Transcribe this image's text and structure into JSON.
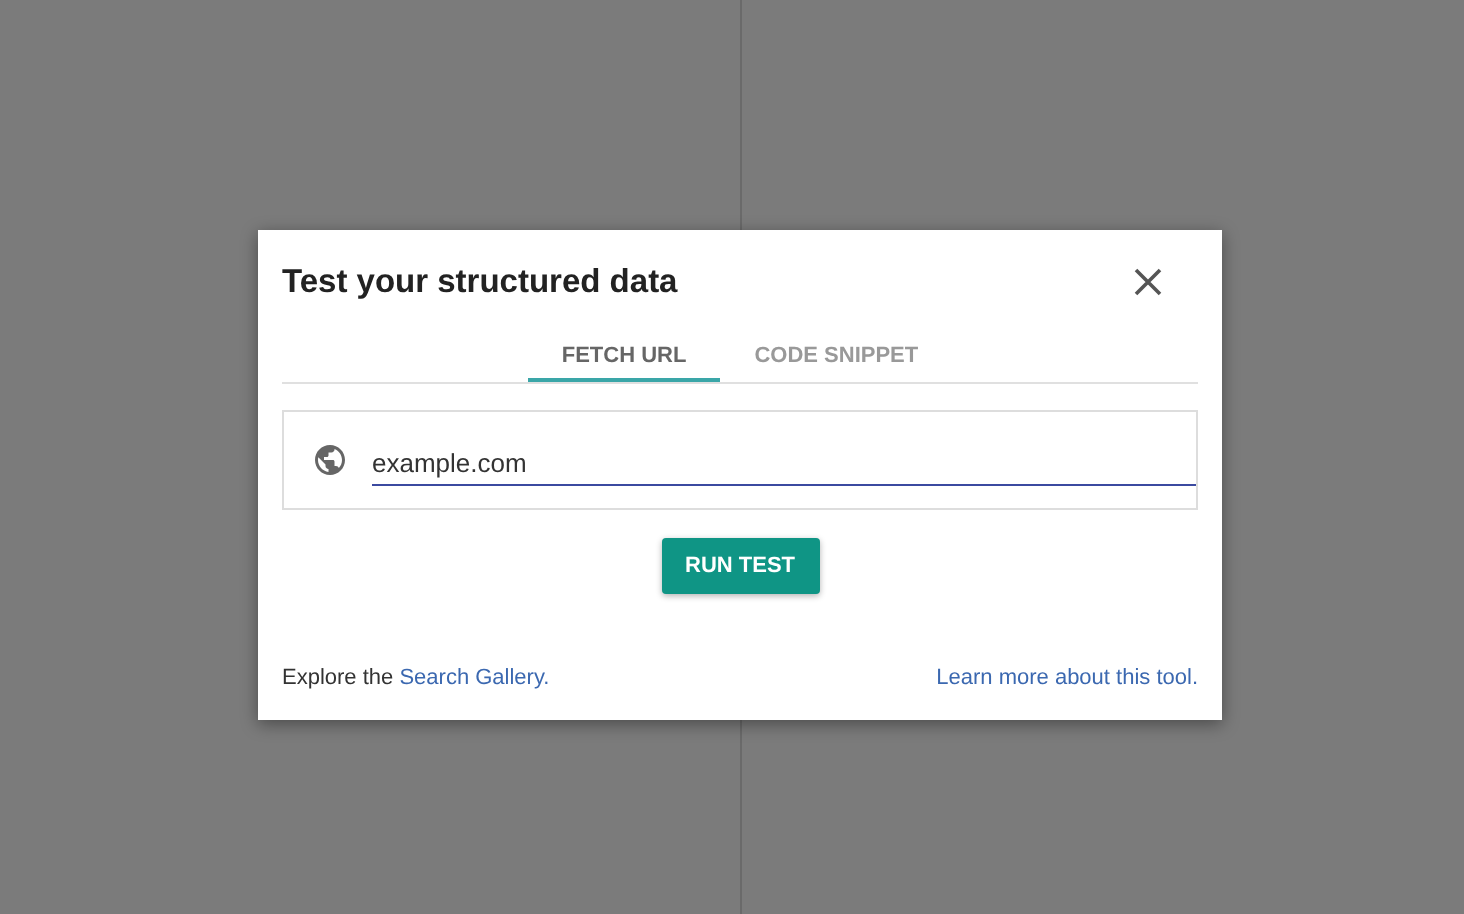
{
  "dialog": {
    "title": "Test your structured data"
  },
  "tabs": [
    {
      "label": "FETCH URL",
      "selected": true
    },
    {
      "label": "CODE SNIPPET",
      "selected": false
    }
  ],
  "url_field": {
    "value": "example.com"
  },
  "run_button": {
    "label": "RUN TEST"
  },
  "footer": {
    "text": "Explore the ",
    "link": "Search Gallery.",
    "help_link": "Learn more about this tool."
  }
}
